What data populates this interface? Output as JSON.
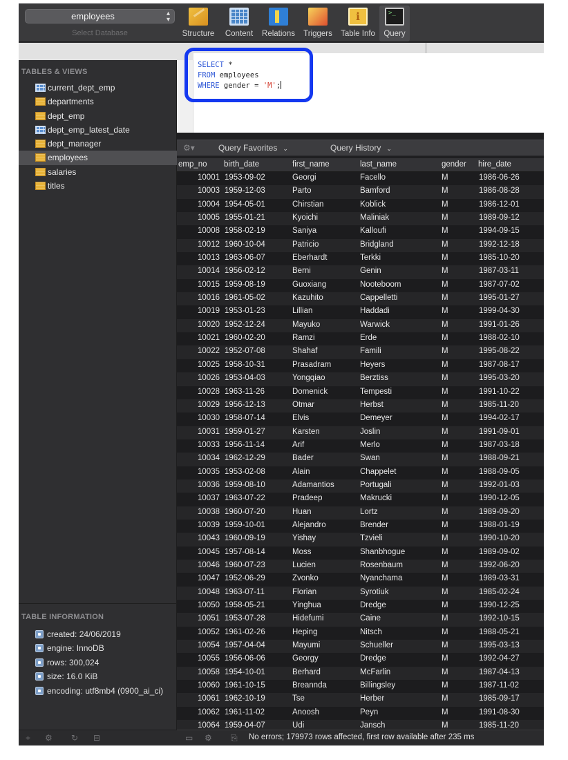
{
  "toolbar": {
    "database": "employees",
    "database_caption": "Select Database",
    "buttons": [
      {
        "label": "Structure",
        "icon": "structure-icon"
      },
      {
        "label": "Content",
        "icon": "content-icon"
      },
      {
        "label": "Relations",
        "icon": "relations-icon"
      },
      {
        "label": "Triggers",
        "icon": "triggers-icon"
      },
      {
        "label": "Table Info",
        "icon": "table-info-icon"
      },
      {
        "label": "Query",
        "icon": "query-icon",
        "active": true
      }
    ]
  },
  "sidebar": {
    "tables_heading": "TABLES & VIEWS",
    "tables": [
      {
        "name": "current_dept_emp",
        "kind": "view"
      },
      {
        "name": "departments",
        "kind": "table"
      },
      {
        "name": "dept_emp",
        "kind": "table"
      },
      {
        "name": "dept_emp_latest_date",
        "kind": "view"
      },
      {
        "name": "dept_manager",
        "kind": "table"
      },
      {
        "name": "employees",
        "kind": "table",
        "selected": true
      },
      {
        "name": "salaries",
        "kind": "table"
      },
      {
        "name": "titles",
        "kind": "table"
      }
    ],
    "info_heading": "TABLE INFORMATION",
    "info": [
      "created: 24/06/2019",
      "engine: InnoDB",
      "rows: 300,024",
      "size: 16.0 KiB",
      "encoding: utf8mb4 (0900_ai_ci)"
    ]
  },
  "editor": {
    "line1_kw": "SELECT",
    "line1_rest": " *",
    "line2_kw": "FROM",
    "line2_rest": " employees",
    "line3_kw": "WHERE",
    "line3_mid": " gender = ",
    "line3_str": "'M'",
    "line3_end": ";"
  },
  "results": {
    "favorites_label": "Query Favorites",
    "history_label": "Query History",
    "columns": [
      "emp_no",
      "birth_date",
      "first_name",
      "last_name",
      "gender",
      "hire_date"
    ],
    "rows": [
      [
        "10001",
        "1953-09-02",
        "Georgi",
        "Facello",
        "M",
        "1986-06-26"
      ],
      [
        "10003",
        "1959-12-03",
        "Parto",
        "Bamford",
        "M",
        "1986-08-28"
      ],
      [
        "10004",
        "1954-05-01",
        "Chirstian",
        "Koblick",
        "M",
        "1986-12-01"
      ],
      [
        "10005",
        "1955-01-21",
        "Kyoichi",
        "Maliniak",
        "M",
        "1989-09-12"
      ],
      [
        "10008",
        "1958-02-19",
        "Saniya",
        "Kalloufi",
        "M",
        "1994-09-15"
      ],
      [
        "10012",
        "1960-10-04",
        "Patricio",
        "Bridgland",
        "M",
        "1992-12-18"
      ],
      [
        "10013",
        "1963-06-07",
        "Eberhardt",
        "Terkki",
        "M",
        "1985-10-20"
      ],
      [
        "10014",
        "1956-02-12",
        "Berni",
        "Genin",
        "M",
        "1987-03-11"
      ],
      [
        "10015",
        "1959-08-19",
        "Guoxiang",
        "Nooteboom",
        "M",
        "1987-07-02"
      ],
      [
        "10016",
        "1961-05-02",
        "Kazuhito",
        "Cappelletti",
        "M",
        "1995-01-27"
      ],
      [
        "10019",
        "1953-01-23",
        "Lillian",
        "Haddadi",
        "M",
        "1999-04-30"
      ],
      [
        "10020",
        "1952-12-24",
        "Mayuko",
        "Warwick",
        "M",
        "1991-01-26"
      ],
      [
        "10021",
        "1960-02-20",
        "Ramzi",
        "Erde",
        "M",
        "1988-02-10"
      ],
      [
        "10022",
        "1952-07-08",
        "Shahaf",
        "Famili",
        "M",
        "1995-08-22"
      ],
      [
        "10025",
        "1958-10-31",
        "Prasadram",
        "Heyers",
        "M",
        "1987-08-17"
      ],
      [
        "10026",
        "1953-04-03",
        "Yongqiao",
        "Berztiss",
        "M",
        "1995-03-20"
      ],
      [
        "10028",
        "1963-11-26",
        "Domenick",
        "Tempesti",
        "M",
        "1991-10-22"
      ],
      [
        "10029",
        "1956-12-13",
        "Otmar",
        "Herbst",
        "M",
        "1985-11-20"
      ],
      [
        "10030",
        "1958-07-14",
        "Elvis",
        "Demeyer",
        "M",
        "1994-02-17"
      ],
      [
        "10031",
        "1959-01-27",
        "Karsten",
        "Joslin",
        "M",
        "1991-09-01"
      ],
      [
        "10033",
        "1956-11-14",
        "Arif",
        "Merlo",
        "M",
        "1987-03-18"
      ],
      [
        "10034",
        "1962-12-29",
        "Bader",
        "Swan",
        "M",
        "1988-09-21"
      ],
      [
        "10035",
        "1953-02-08",
        "Alain",
        "Chappelet",
        "M",
        "1988-09-05"
      ],
      [
        "10036",
        "1959-08-10",
        "Adamantios",
        "Portugali",
        "M",
        "1992-01-03"
      ],
      [
        "10037",
        "1963-07-22",
        "Pradeep",
        "Makrucki",
        "M",
        "1990-12-05"
      ],
      [
        "10038",
        "1960-07-20",
        "Huan",
        "Lortz",
        "M",
        "1989-09-20"
      ],
      [
        "10039",
        "1959-10-01",
        "Alejandro",
        "Brender",
        "M",
        "1988-01-19"
      ],
      [
        "10043",
        "1960-09-19",
        "Yishay",
        "Tzvieli",
        "M",
        "1990-10-20"
      ],
      [
        "10045",
        "1957-08-14",
        "Moss",
        "Shanbhogue",
        "M",
        "1989-09-02"
      ],
      [
        "10046",
        "1960-07-23",
        "Lucien",
        "Rosenbaum",
        "M",
        "1992-06-20"
      ],
      [
        "10047",
        "1952-06-29",
        "Zvonko",
        "Nyanchama",
        "M",
        "1989-03-31"
      ],
      [
        "10048",
        "1963-07-11",
        "Florian",
        "Syrotiuk",
        "M",
        "1985-02-24"
      ],
      [
        "10050",
        "1958-05-21",
        "Yinghua",
        "Dredge",
        "M",
        "1990-12-25"
      ],
      [
        "10051",
        "1953-07-28",
        "Hidefumi",
        "Caine",
        "M",
        "1992-10-15"
      ],
      [
        "10052",
        "1961-02-26",
        "Heping",
        "Nitsch",
        "M",
        "1988-05-21"
      ],
      [
        "10054",
        "1957-04-04",
        "Mayumi",
        "Schueller",
        "M",
        "1995-03-13"
      ],
      [
        "10055",
        "1956-06-06",
        "Georgy",
        "Dredge",
        "M",
        "1992-04-27"
      ],
      [
        "10058",
        "1954-10-01",
        "Berhard",
        "McFarlin",
        "M",
        "1987-04-13"
      ],
      [
        "10060",
        "1961-10-15",
        "Breannda",
        "Billingsley",
        "M",
        "1987-11-02"
      ],
      [
        "10061",
        "1962-10-19",
        "Tse",
        "Herber",
        "M",
        "1985-09-17"
      ],
      [
        "10062",
        "1961-11-02",
        "Anoosh",
        "Peyn",
        "M",
        "1991-08-30"
      ],
      [
        "10064",
        "1959-04-07",
        "Udi",
        "Jansch",
        "M",
        "1985-11-20"
      ]
    ],
    "status": "No errors; 179973 rows affected, first row available after 235 ms"
  }
}
